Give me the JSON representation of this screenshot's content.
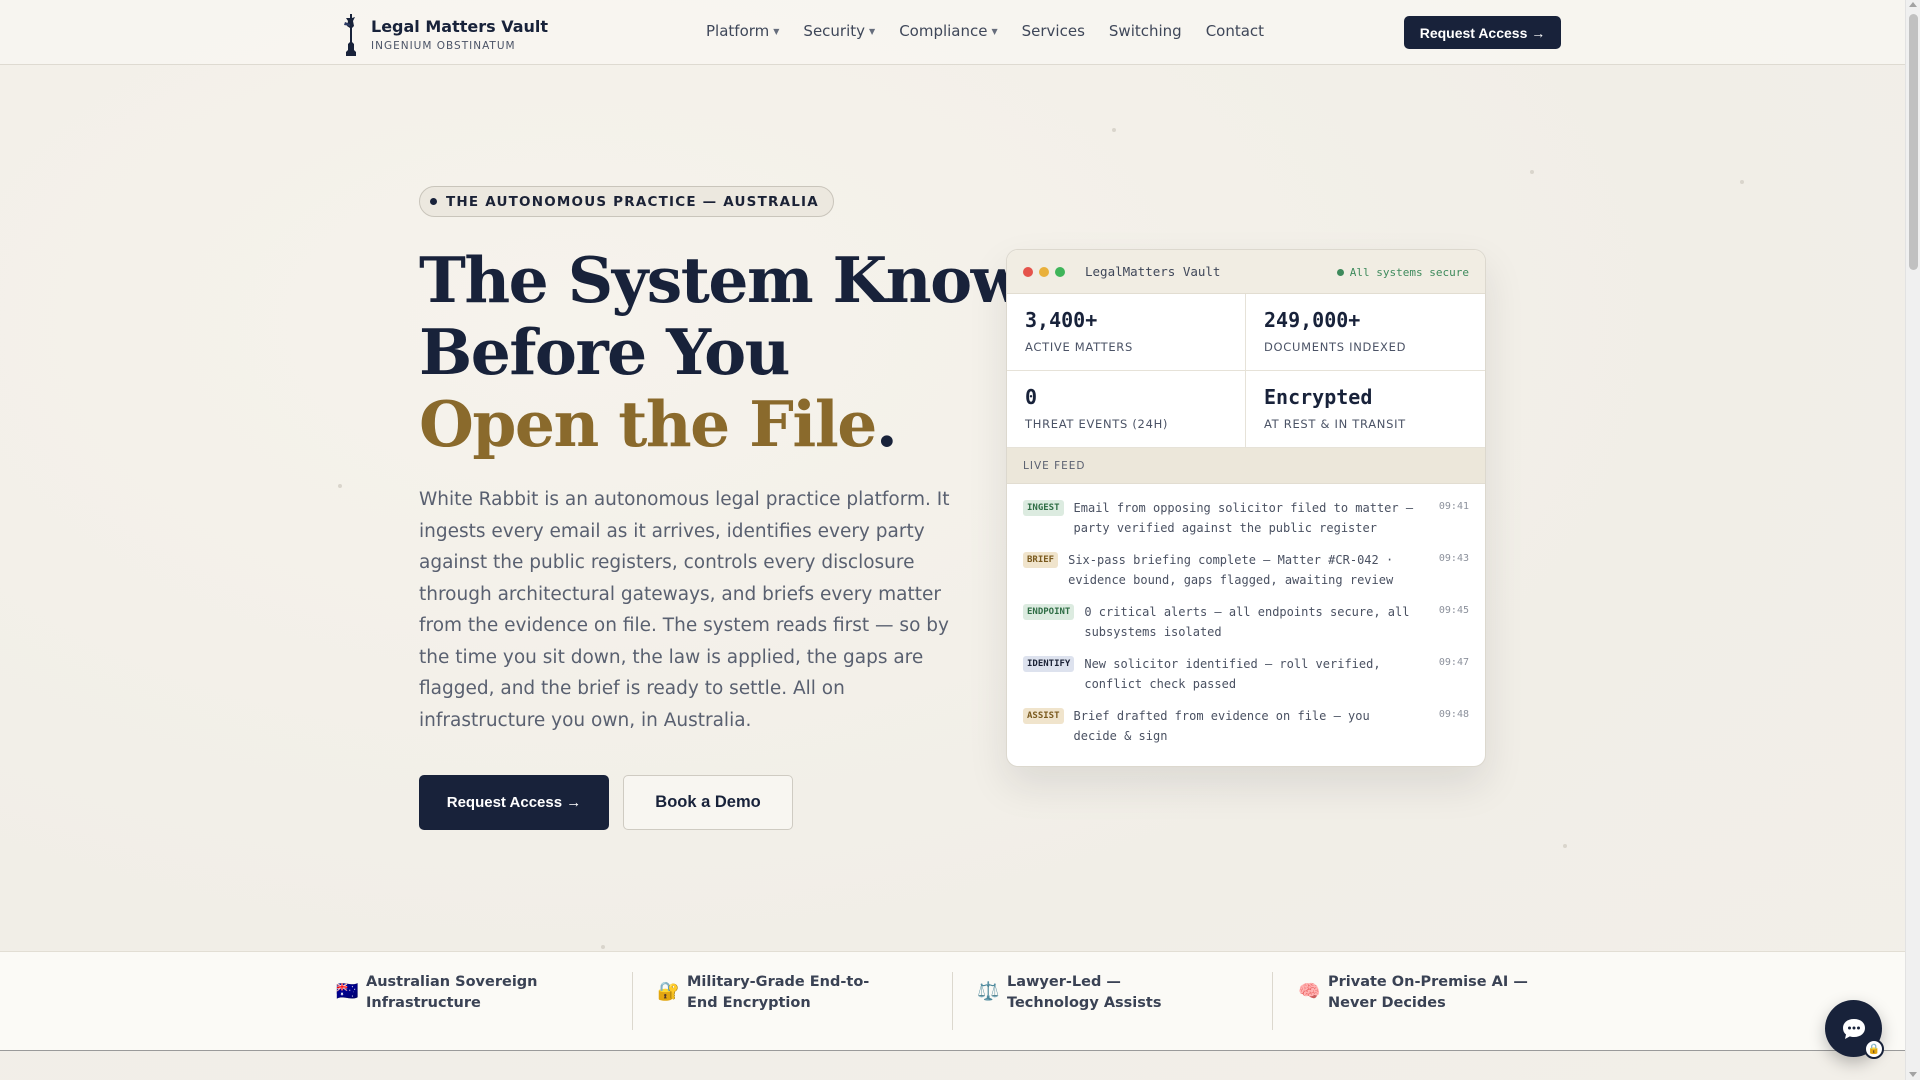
{
  "nav": {
    "brand_name": "Legal Matters Vault",
    "brand_tagline": "INGENIUM OBSTINATUM",
    "items": [
      {
        "label": "Platform",
        "dropdown": true
      },
      {
        "label": "Security",
        "dropdown": true
      },
      {
        "label": "Compliance",
        "dropdown": true
      },
      {
        "label": "Services",
        "dropdown": false
      },
      {
        "label": "Switching",
        "dropdown": false
      },
      {
        "label": "Contact",
        "dropdown": false
      }
    ],
    "cta_label": "Request Access →"
  },
  "hero": {
    "eyebrow": "THE AUTONOMOUS PRACTICE — AUSTRALIA",
    "headline_line1": "The System Knows",
    "headline_line2": "Before You",
    "headline_accent": "Open the File",
    "headline_period": ".",
    "lede": "White Rabbit is an autonomous legal practice platform. It ingests every email as it arrives, identifies every party against the public registers, controls every disclosure through architectural gateways, and briefs every matter from the evidence on file. The system reads first — so by the time you sit down, the law is applied, the gaps are flagged, and the brief is ready to settle. All on infrastructure you own, in Australia.",
    "primary_cta": "Request Access →",
    "secondary_cta": "Book a Demo"
  },
  "vault": {
    "title": "LegalMatters Vault",
    "status": "All systems secure",
    "stats": [
      {
        "value": "3,400+",
        "label": "ACTIVE MATTERS"
      },
      {
        "value": "249,000+",
        "label": "DOCUMENTS INDEXED"
      },
      {
        "value": "0",
        "label": "THREAT EVENTS (24H)"
      },
      {
        "value": "Encrypted",
        "label": "AT REST & IN TRANSIT"
      }
    ],
    "feed_title": "LIVE FEED",
    "feed": [
      {
        "tag": "INGEST",
        "text": "Email from opposing solicitor filed to matter — party verified against the public register",
        "time": "09:41"
      },
      {
        "tag": "BRIEF",
        "text": "Six-pass briefing complete — Matter #CR-042 · evidence bound, gaps flagged, awaiting review",
        "time": "09:43"
      },
      {
        "tag": "ENDPOINT",
        "text": "0 critical alerts — all endpoints secure, all subsystems isolated",
        "time": "09:45"
      },
      {
        "tag": "IDENTIFY",
        "text": "New solicitor identified — roll verified, conflict check passed",
        "time": "09:47"
      },
      {
        "tag": "ASSIST",
        "text": "Brief drafted from evidence on file — you decide & sign",
        "time": "09:48"
      }
    ]
  },
  "features": [
    {
      "icon": "australia-flag-icon",
      "glyph": "🇦🇺",
      "label": "Australian Sovereign Infrastructure"
    },
    {
      "icon": "lock-key-icon",
      "glyph": "🔐",
      "label": "Military-Grade End-to-End Encryption"
    },
    {
      "icon": "scales-icon",
      "glyph": "⚖️",
      "label": "Lawyer-Led — Technology Assists"
    },
    {
      "icon": "brain-icon",
      "glyph": "🧠",
      "label": "Private On-Premise AI — Never Decides"
    }
  ],
  "colors": {
    "navy": "#18223a",
    "gold_accent": "#8a6a2c",
    "status_green": "#3e8a5c"
  }
}
